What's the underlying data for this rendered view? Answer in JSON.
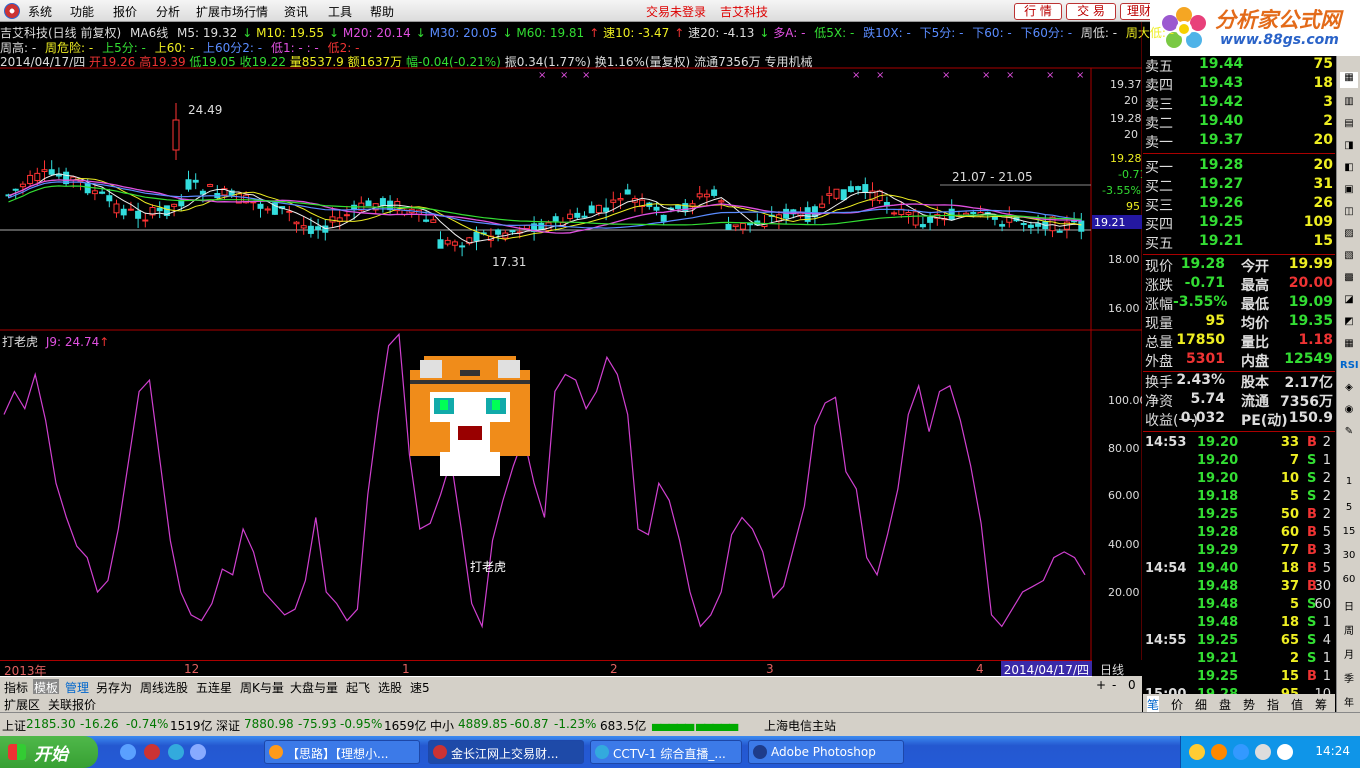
{
  "menubar": {
    "items": [
      "系统",
      "功能",
      "报价",
      "分析",
      "扩展市场行情",
      "资讯",
      "工具",
      "帮助"
    ],
    "not_logged": "交易未登录",
    "stock_name": "吉艾科技",
    "btn_quote": "行 情",
    "btn_trade": "交 易",
    "btn_finance": "理财"
  },
  "brand": {
    "name": "分析家公式网",
    "url": "www.88gs.com"
  },
  "info_line1": {
    "name": "吉艾科技(日线 前复权)",
    "ma_title": "MA6线",
    "m5": "M5: 19.32",
    "m10": "M10: 19.55",
    "m20": "M20: 20.14",
    "m30": "M30: 20.05",
    "m60": "M60: 19.81",
    "su": "速10: -3.47",
    "su20": "速20: -4.13",
    "duo": "多A: -",
    "di5x": "低5X: -",
    "die10x": "跌10X: -",
    "xia5": "下5分: -",
    "xia60": "下60: -",
    "xia60f": "下60分: -",
    "zhoudi": "周低: -",
    "zhouda": "周大低: -"
  },
  "info_line2": {
    "zhougao": "周高: -",
    "zhouwei": "周危险: -",
    "shang5": "上5分: -",
    "shang60": "上60: -",
    "shang60f": "上60分2: -",
    "di1": "低1: - : -",
    "di2": "低2: -"
  },
  "info_line3": {
    "date": "2014/04/17/四",
    "kai": "开19.26",
    "gao": "高19.39",
    "di": "低19.05",
    "shou": "收19.22",
    "liang": "量8537.9",
    "e": "额1637万",
    "fu": "幅-0.04(-0.21%)",
    "zhen": "振0.34(1.77%)",
    "huan": "换1.16%(量复权)",
    "liutong": "流通7356万",
    "industry": "专用机械"
  },
  "chart_labels": {
    "high_mark": "24.49",
    "low_mark": "17.31",
    "range_mark": "21.07 - 21.05",
    "price_axis": [
      "19.37",
      "20",
      "19.28",
      "20",
      "19.28",
      "-0.71",
      "-3.55%",
      "95",
      "19.21",
      "18.00",
      "16.00"
    ],
    "ind_axis": [
      "100.00",
      "80.00",
      "60.00",
      "40.00",
      "20.00"
    ]
  },
  "indicator": {
    "name": "打老虎",
    "value": "J9: 24.74",
    "caption": "打老虎"
  },
  "chart_data": {
    "type": "line",
    "title": "打老虎",
    "series": [
      {
        "name": "J9",
        "values": [
          84,
          92,
          86,
          98,
          82,
          60,
          48,
          38,
          34,
          22,
          26,
          44,
          68,
          92,
          96,
          68,
          40,
          22,
          14,
          12,
          18,
          30,
          28,
          44,
          36,
          22,
          18,
          14,
          16,
          26,
          48,
          22,
          18,
          12,
          16,
          56,
          84,
          108,
          112,
          70,
          44,
          46,
          56,
          68,
          44,
          18,
          10,
          40,
          54,
          66,
          76,
          60,
          48,
          92,
          98,
          96,
          86,
          92,
          104,
          98,
          84,
          44,
          42,
          60,
          54,
          40,
          22,
          10,
          14,
          22,
          42,
          48,
          44,
          36,
          20,
          24,
          38,
          52,
          80,
          88,
          90,
          64,
          58,
          34,
          28,
          42,
          58,
          84,
          94,
          78,
          92,
          94,
          82,
          66,
          46,
          14,
          10,
          16,
          22,
          24,
          26,
          34,
          36,
          34,
          28
        ]
      }
    ],
    "ylim": [
      0,
      110
    ]
  },
  "xaxis": {
    "labels": [
      "2013年",
      "12",
      "1",
      "2",
      "3",
      "4"
    ],
    "date": "2014/04/17/四"
  },
  "dayline": "日线",
  "bottom_tabs": [
    "指标",
    "模板",
    "管理",
    "另存为",
    "周线选股",
    "五连星",
    "周K与量",
    "大盘与量",
    "起飞",
    "选股",
    "速5"
  ],
  "bottom_tabs2": [
    "扩展区",
    "关联报价"
  ],
  "zoom": [
    "+",
    "-",
    "0"
  ],
  "orderbook": {
    "sells": [
      {
        "label": "卖五",
        "price": "19.44",
        "vol": "75"
      },
      {
        "label": "卖四",
        "price": "19.43",
        "vol": "18"
      },
      {
        "label": "卖三",
        "price": "19.42",
        "vol": "3"
      },
      {
        "label": "卖二",
        "price": "19.40",
        "vol": "2"
      },
      {
        "label": "卖一",
        "price": "19.37",
        "vol": "20"
      }
    ],
    "buys": [
      {
        "label": "买一",
        "price": "19.28",
        "vol": "20"
      },
      {
        "label": "买二",
        "price": "19.27",
        "vol": "31"
      },
      {
        "label": "买三",
        "price": "19.26",
        "vol": "26"
      },
      {
        "label": "买四",
        "price": "19.25",
        "vol": "109"
      },
      {
        "label": "买五",
        "price": "19.21",
        "vol": "15"
      }
    ]
  },
  "quote": [
    {
      "l1": "现价",
      "v1": "19.28",
      "l2": "今开",
      "v2": "19.99"
    },
    {
      "l1": "涨跌",
      "v1": "-0.71",
      "l2": "最高",
      "v2": "20.00"
    },
    {
      "l1": "涨幅",
      "v1": "-3.55%",
      "l2": "最低",
      "v2": "19.09"
    },
    {
      "l1": "现量",
      "v1": "95",
      "l2": "均价",
      "v2": "19.35"
    },
    {
      "l1": "总量",
      "v1": "17850",
      "l2": "量比",
      "v2": "1.18"
    },
    {
      "l1": "外盘",
      "v1": "5301",
      "l2": "内盘",
      "v2": "12549"
    },
    {
      "l1": "换手",
      "v1": "2.43%",
      "l2": "股本",
      "v2": "2.17亿"
    },
    {
      "l1": "净资",
      "v1": "5.74",
      "l2": "流通",
      "v2": "7356万"
    },
    {
      "l1": "收益(一)",
      "v1": "0.032",
      "l2": "PE(动)",
      "v2": "150.9"
    }
  ],
  "ticks": [
    {
      "time": "14:53",
      "price": "19.20",
      "vol": "33",
      "side": "B",
      "n": "2"
    },
    {
      "time": "",
      "price": "19.20",
      "vol": "7",
      "side": "S",
      "n": "1"
    },
    {
      "time": "",
      "price": "19.20",
      "vol": "10",
      "side": "S",
      "n": "2"
    },
    {
      "time": "",
      "price": "19.18",
      "vol": "5",
      "side": "S",
      "n": "2"
    },
    {
      "time": "",
      "price": "19.25",
      "vol": "50",
      "side": "B",
      "n": "2"
    },
    {
      "time": "",
      "price": "19.28",
      "vol": "60",
      "side": "B",
      "n": "5"
    },
    {
      "time": "",
      "price": "19.29",
      "vol": "77",
      "side": "B",
      "n": "3"
    },
    {
      "time": "14:54",
      "price": "19.40",
      "vol": "18",
      "side": "B",
      "n": "5"
    },
    {
      "time": "",
      "price": "19.48",
      "vol": "37",
      "side": "B",
      "n": "30"
    },
    {
      "time": "",
      "price": "19.48",
      "vol": "5",
      "side": "S",
      "n": "60"
    },
    {
      "time": "",
      "price": "19.48",
      "vol": "18",
      "side": "S",
      "n": "1"
    },
    {
      "time": "14:55",
      "price": "19.25",
      "vol": "65",
      "side": "S",
      "n": "4"
    },
    {
      "time": "",
      "price": "19.21",
      "vol": "2",
      "side": "S",
      "n": "1"
    },
    {
      "time": "",
      "price": "19.25",
      "vol": "15",
      "side": "B",
      "n": "1"
    },
    {
      "time": "15:00",
      "price": "19.28",
      "vol": "95",
      "side": "",
      "n": "10"
    }
  ],
  "right_tabs": [
    "笔",
    "价",
    "细",
    "盘",
    "势",
    "指",
    "值",
    "筹"
  ],
  "statusbar": {
    "sh": "上证",
    "sh_val": "2185.30",
    "sh_chg": "-16.26",
    "sh_pct": "-0.74%",
    "sh_amt": "1519亿",
    "sz": "深证",
    "sz_val": "7880.98",
    "sz_chg": "-75.93",
    "sz_pct": "-0.95%",
    "sz_amt": "1659亿",
    "zx": "中小",
    "zx_val": "4889.85",
    "zx_chg": "-60.87",
    "zx_pct": "-1.23%",
    "zx_amt": "683.5亿",
    "station": "上海电信主站"
  },
  "taskbar": {
    "start": "开始",
    "items": [
      "【思路】【理想小...",
      "金长江网上交易财...",
      "CCTV-1 综合直播_...",
      "Adobe Photoshop"
    ],
    "clock": "14:24"
  },
  "colors": {
    "up": "#ff3333",
    "down": "#33dddd",
    "axis": "#aa0000",
    "green": "#33dd33",
    "magenta": "#e050e0"
  }
}
